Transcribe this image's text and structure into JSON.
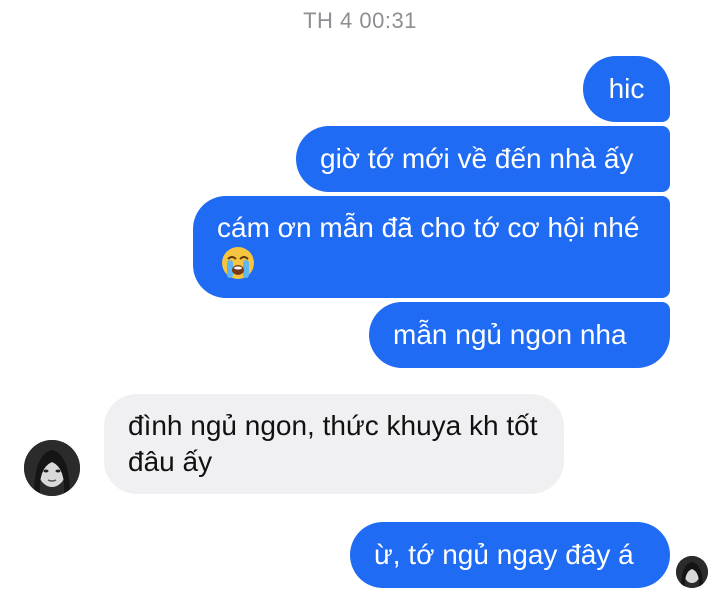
{
  "chat": {
    "timestamp": "TH 4 00:31",
    "messages": [
      {
        "from": "me",
        "text": "hic"
      },
      {
        "from": "me",
        "text": "giờ tớ mới về đến nhà ấy"
      },
      {
        "from": "me",
        "text": "cám ơn mẫn đã cho tớ cơ hội nhé",
        "emoji": "loudly-crying-face"
      },
      {
        "from": "me",
        "text": "mẫn ngủ ngon nha"
      },
      {
        "from": "them",
        "text": "đình ngủ ngon, thức khuya kh tốt đâu ấy"
      },
      {
        "from": "me",
        "text": "ừ, tớ ngủ ngay đây á"
      }
    ]
  },
  "colors": {
    "outgoing_bubble": "#1f6bf3",
    "incoming_bubble": "#f0f0f2",
    "timestamp_text": "#8e8e93"
  }
}
